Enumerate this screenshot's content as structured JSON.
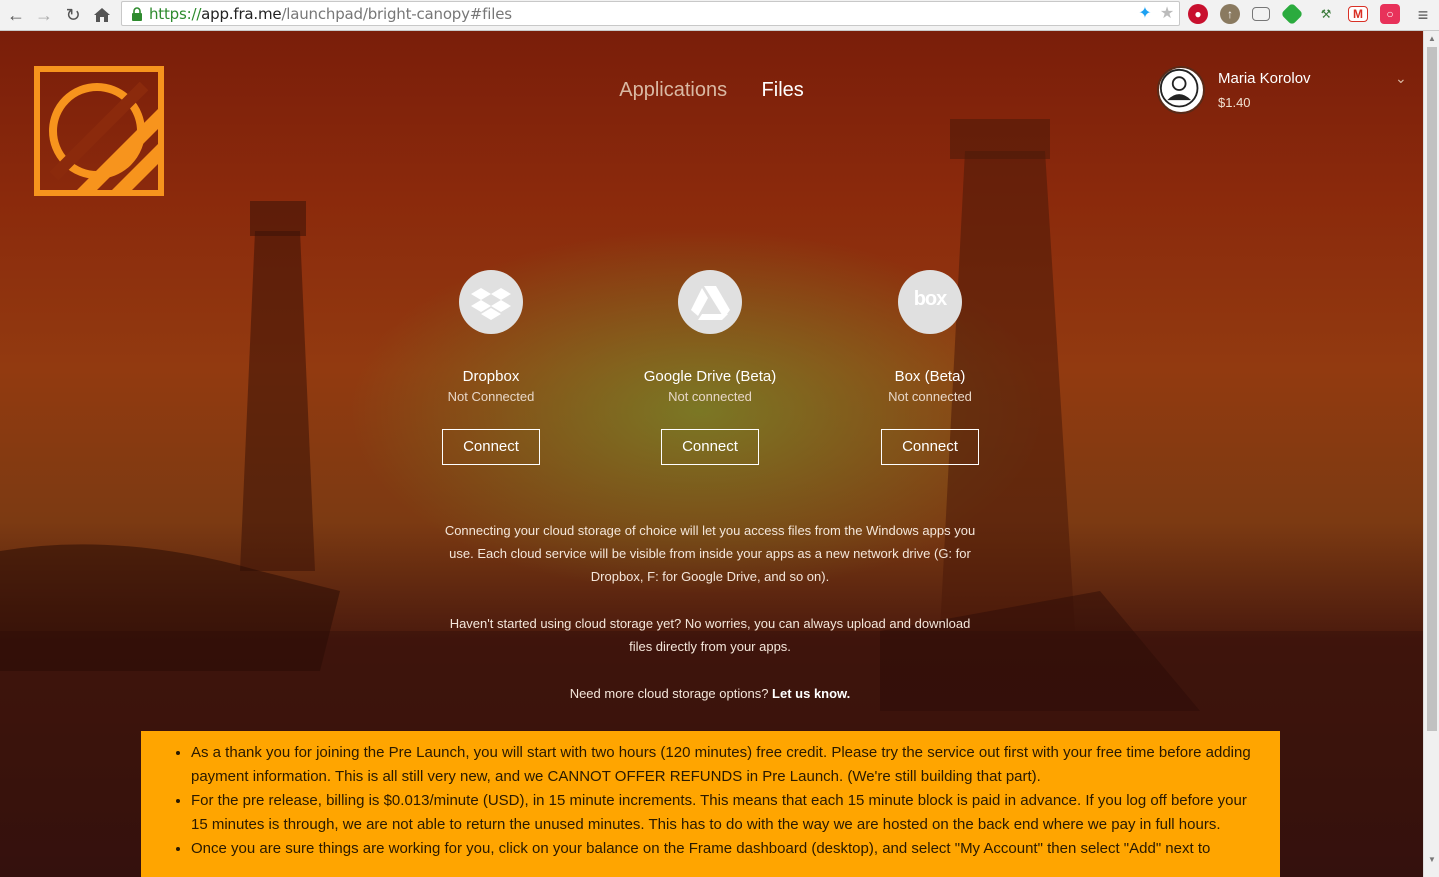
{
  "browser": {
    "url_scheme": "https://",
    "url_host": "app.fra.me",
    "url_path": "/launchpad/bright-canopy#files",
    "back_icon": "arrow-left-icon",
    "forward_icon": "arrow-right-icon",
    "reload_icon": "reload-icon",
    "home_icon": "home-icon",
    "menu_icon": "hamburger-icon"
  },
  "nav": {
    "applications_label": "Applications",
    "files_label": "Files",
    "active": "Files"
  },
  "user": {
    "name": "Maria Korolov",
    "balance": "$1.40"
  },
  "services": [
    {
      "name": "Dropbox",
      "status": "Not Connected",
      "button": "Connect",
      "icon": "dropbox-icon"
    },
    {
      "name": "Google Drive (Beta)",
      "status": "Not connected",
      "button": "Connect",
      "icon": "google-drive-icon"
    },
    {
      "name": "Box (Beta)",
      "status": "Not connected",
      "button": "Connect",
      "icon": "box-icon",
      "icon_text": "box"
    }
  ],
  "info": {
    "para1": "Connecting your cloud storage of choice will let you access files from the Windows apps you use. Each cloud service will be visible from inside your apps as a new network drive (G: for Dropbox, F: for Google Drive, and so on).",
    "para2": "Haven't started using cloud storage yet? No worries, you can always upload and download files directly from your apps.",
    "para3_prefix": "Need more cloud storage options?",
    "para3_link": "Let us know."
  },
  "notice": {
    "items": [
      "As a thank you for joining the Pre Launch, you will start with two hours (120 minutes) free credit. Please try the service out first with your free time before adding payment information. This is all still very new, and we CANNOT OFFER REFUNDS in Pre Launch. (We're still building that part).",
      "For the pre release, billing is $0.013/minute (USD), in 15 minute increments. This means that each 15 minute block is paid in advance. If you log off before your 15 minutes is through, we are not able to return the unused minutes. This has to do with the way we are hosted on the back end where we pay in full hours.",
      "Once you are sure things are working for you, click on your balance on the Frame dashboard (desktop), and select \"My Account\" then select \"Add\" next to"
    ]
  },
  "colors": {
    "accent_orange": "#f7941d",
    "notice_bg": "#ffa500"
  }
}
